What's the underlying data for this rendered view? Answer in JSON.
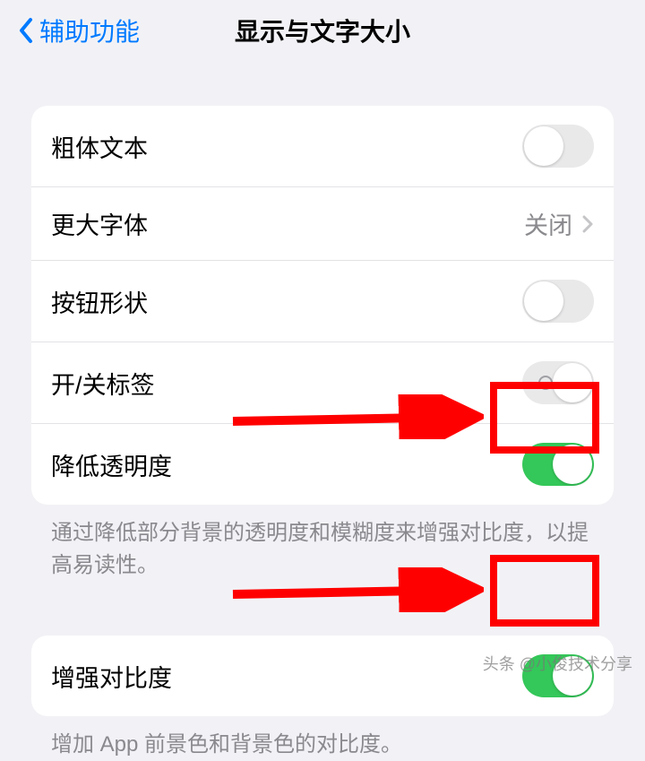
{
  "navbar": {
    "back_label": "辅助功能",
    "title": "显示与文字大小"
  },
  "group1": {
    "rows": [
      {
        "label": "粗体文本",
        "type": "toggle",
        "state": "off"
      },
      {
        "label": "更大字体",
        "type": "link",
        "value": "关闭"
      },
      {
        "label": "按钮形状",
        "type": "toggle",
        "state": "off"
      },
      {
        "label": "开/关标签",
        "type": "toggle",
        "state": "off-label"
      },
      {
        "label": "降低透明度",
        "type": "toggle",
        "state": "on"
      }
    ],
    "footer": "通过降低部分背景的透明度和模糊度来增强对比度，以提高易读性。"
  },
  "group2": {
    "rows": [
      {
        "label": "增强对比度",
        "type": "toggle",
        "state": "on"
      }
    ],
    "footer": "增加 App 前景色和背景色的对比度。"
  },
  "annotations": {
    "highlight_color": "#ff0000",
    "arrow_color": "#ff0000"
  },
  "watermark": "头条 @小俊技术分享"
}
